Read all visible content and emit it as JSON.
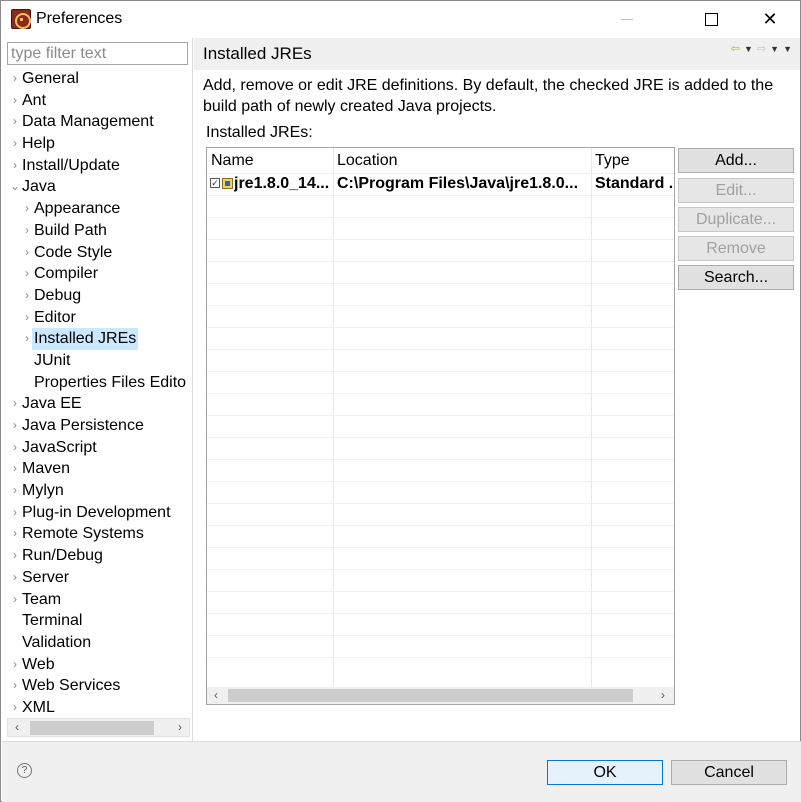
{
  "window": {
    "title": "Preferences"
  },
  "filter": {
    "placeholder": "type filter text",
    "value": ""
  },
  "tree": {
    "items": [
      {
        "label": "General",
        "level": 0,
        "arrow": "›"
      },
      {
        "label": "Ant",
        "level": 0,
        "arrow": "›"
      },
      {
        "label": "Data Management",
        "level": 0,
        "arrow": "›"
      },
      {
        "label": "Help",
        "level": 0,
        "arrow": "›"
      },
      {
        "label": "Install/Update",
        "level": 0,
        "arrow": "›"
      },
      {
        "label": "Java",
        "level": 0,
        "arrow": "⌄"
      },
      {
        "label": "Appearance",
        "level": 1,
        "arrow": "›"
      },
      {
        "label": "Build Path",
        "level": 1,
        "arrow": "›"
      },
      {
        "label": "Code Style",
        "level": 1,
        "arrow": "›"
      },
      {
        "label": "Compiler",
        "level": 1,
        "arrow": "›"
      },
      {
        "label": "Debug",
        "level": 1,
        "arrow": "›"
      },
      {
        "label": "Editor",
        "level": 1,
        "arrow": "›"
      },
      {
        "label": "Installed JREs",
        "level": 1,
        "arrow": "›",
        "selected": true
      },
      {
        "label": "JUnit",
        "level": 1,
        "arrow": ""
      },
      {
        "label": "Properties Files Edito",
        "level": 1,
        "arrow": ""
      },
      {
        "label": "Java EE",
        "level": 0,
        "arrow": "›"
      },
      {
        "label": "Java Persistence",
        "level": 0,
        "arrow": "›"
      },
      {
        "label": "JavaScript",
        "level": 0,
        "arrow": "›"
      },
      {
        "label": "Maven",
        "level": 0,
        "arrow": "›"
      },
      {
        "label": "Mylyn",
        "level": 0,
        "arrow": "›"
      },
      {
        "label": "Plug-in Development",
        "level": 0,
        "arrow": "›"
      },
      {
        "label": "Remote Systems",
        "level": 0,
        "arrow": "›"
      },
      {
        "label": "Run/Debug",
        "level": 0,
        "arrow": "›"
      },
      {
        "label": "Server",
        "level": 0,
        "arrow": "›"
      },
      {
        "label": "Team",
        "level": 0,
        "arrow": "›"
      },
      {
        "label": "Terminal",
        "level": 0,
        "arrow": ""
      },
      {
        "label": "Validation",
        "level": 0,
        "arrow": ""
      },
      {
        "label": "Web",
        "level": 0,
        "arrow": "›"
      },
      {
        "label": "Web Services",
        "level": 0,
        "arrow": "›"
      },
      {
        "label": "XML",
        "level": 0,
        "arrow": "›"
      }
    ]
  },
  "page": {
    "title": "Installed JREs",
    "description": "Add, remove or edit JRE definitions. By default, the checked JRE is added to the build path of newly created Java projects.",
    "table_label": "Installed JREs:"
  },
  "table": {
    "columns": [
      "Name",
      "Location",
      "Type"
    ],
    "rows": [
      {
        "checked": true,
        "name": "jre1.8.0_14...",
        "location": "C:\\Program Files\\Java\\jre1.8.0...",
        "type": "Standard ..."
      }
    ]
  },
  "buttons": {
    "add": "Add...",
    "edit": "Edit...",
    "duplicate": "Duplicate...",
    "remove": "Remove",
    "search": "Search...",
    "ok": "OK",
    "cancel": "Cancel"
  },
  "icons": {
    "help": "?",
    "scroll_left": "‹",
    "scroll_right": "›",
    "close": "✕",
    "back": "⇦",
    "forward": "⇨",
    "dropdown": "▼"
  },
  "colors": {
    "selection": "#cce8ff",
    "ok_border": "#0078d7"
  }
}
